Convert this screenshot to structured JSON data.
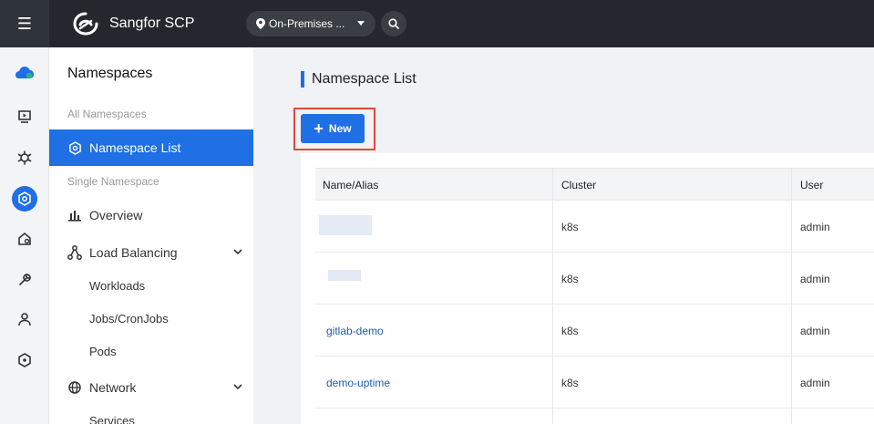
{
  "app": {
    "name": "Sangfor SCP",
    "environment": "On-Premises ..."
  },
  "sidenav": {
    "title": "Namespaces",
    "group_all": "All Namespaces",
    "item_namespace_list": "Namespace List",
    "group_single": "Single Namespace",
    "item_overview": "Overview",
    "item_load_balancing": "Load Balancing",
    "sub_workloads": "Workloads",
    "sub_jobs": "Jobs/CronJobs",
    "sub_pods": "Pods",
    "item_network": "Network",
    "sub_services": "Services"
  },
  "main": {
    "title": "Namespace List",
    "new_button": "New"
  },
  "table": {
    "columns": [
      "Name/Alias",
      "Cluster",
      "User"
    ],
    "rows": [
      {
        "name": "",
        "cluster": "k8s",
        "user": "admin"
      },
      {
        "name": "",
        "cluster": "k8s",
        "user": "admin"
      },
      {
        "name": "gitlab-demo",
        "cluster": "k8s",
        "user": "admin"
      },
      {
        "name": "demo-uptime",
        "cluster": "k8s",
        "user": "admin"
      }
    ]
  },
  "colors": {
    "accent": "#1f6fe5",
    "topbar": "#24282e",
    "highlight": "#e5473a",
    "link": "#1f5bb8"
  }
}
